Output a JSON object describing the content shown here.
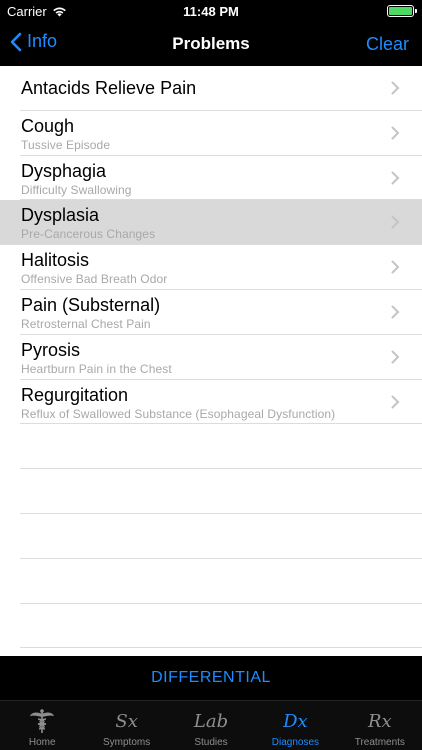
{
  "status_bar": {
    "carrier": "Carrier",
    "time": "11:48 PM"
  },
  "nav": {
    "back_label": "Info",
    "title": "Problems",
    "clear_label": "Clear"
  },
  "rows": [
    {
      "title": "Antacids Relieve Pain",
      "subtitle": ""
    },
    {
      "title": "Cough",
      "subtitle": "Tussive Episode"
    },
    {
      "title": "Dysphagia",
      "subtitle": "Difficulty Swallowing"
    },
    {
      "title": "Dysplasia",
      "subtitle": "Pre-Cancerous Changes"
    },
    {
      "title": "Halitosis",
      "subtitle": "Offensive Bad Breath Odor"
    },
    {
      "title": "Pain (Substernal)",
      "subtitle": "Retrosternal Chest Pain"
    },
    {
      "title": "Pyrosis",
      "subtitle": "Heartburn Pain in the Chest"
    },
    {
      "title": "Regurgitation",
      "subtitle": "Reflux of Swallowed Substance (Esophageal Dysfunction)"
    }
  ],
  "differential_label": "DIFFERENTIAL",
  "tabs": [
    {
      "label": "Home",
      "icon": "caduceus-icon",
      "glyph": ""
    },
    {
      "label": "Symptoms",
      "icon": "sx-icon",
      "glyph": "Sx"
    },
    {
      "label": "Studies",
      "icon": "lab-icon",
      "glyph": "Lab"
    },
    {
      "label": "Diagnoses",
      "icon": "dx-icon",
      "glyph": "Dx"
    },
    {
      "label": "Treatments",
      "icon": "rx-icon",
      "glyph": "Rx"
    }
  ],
  "colors": {
    "accent": "#1e8cff",
    "selected_row": "#d9d9d9",
    "battery": "#4cd964"
  }
}
